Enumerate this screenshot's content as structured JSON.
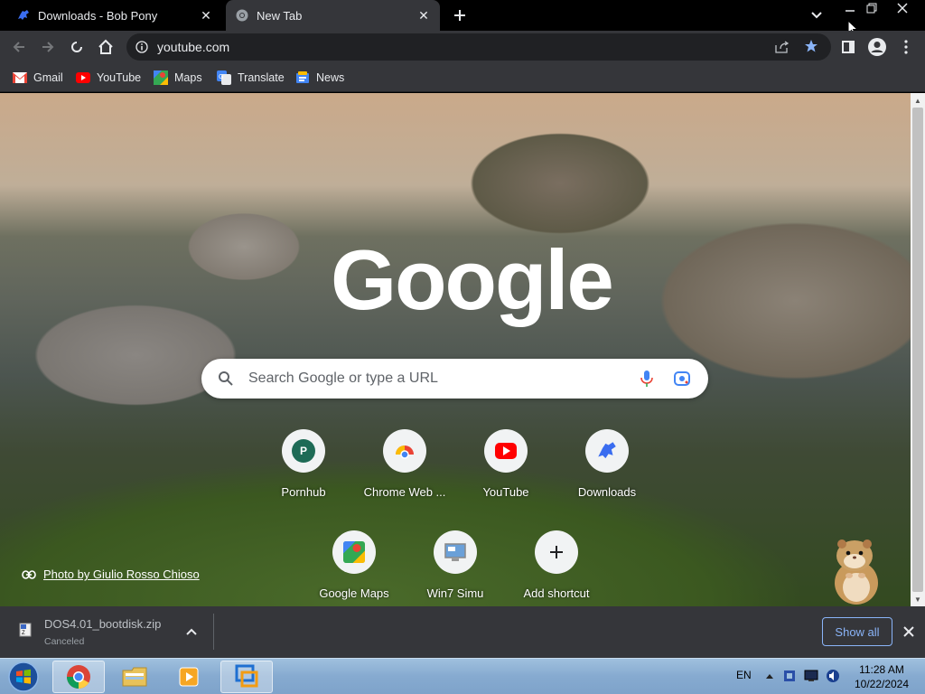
{
  "tabs": [
    {
      "title": "Downloads - Bob Pony",
      "active": false,
      "icon": "bob-pony-icon"
    },
    {
      "title": "New Tab",
      "active": true,
      "icon": "chrome-icon"
    }
  ],
  "toolbar": {
    "url": "youtube.com"
  },
  "bookmarks": [
    {
      "label": "Gmail",
      "icon": "gmail-icon"
    },
    {
      "label": "YouTube",
      "icon": "youtube-icon"
    },
    {
      "label": "Maps",
      "icon": "maps-icon"
    },
    {
      "label": "Translate",
      "icon": "translate-icon"
    },
    {
      "label": "News",
      "icon": "news-icon"
    }
  ],
  "ntp": {
    "logo": "Google",
    "search_placeholder": "Search Google or type a URL",
    "shortcuts": [
      {
        "label": "Pornhub",
        "icon": "letter-p-icon",
        "letter": "P"
      },
      {
        "label": "Chrome Web ...",
        "icon": "chrome-web-store-icon"
      },
      {
        "label": "YouTube",
        "icon": "youtube-icon"
      },
      {
        "label": "Downloads",
        "icon": "bob-pony-icon"
      },
      {
        "label": "Google Maps",
        "icon": "maps-icon"
      },
      {
        "label": "Win7 Simu",
        "icon": "win7-simu-icon"
      },
      {
        "label": "Add shortcut",
        "icon": "plus-icon"
      }
    ],
    "photo_credit": "Photo by Giulio Rosso Chioso"
  },
  "download_bar": {
    "file": "DOS4.01_bootdisk.zip",
    "status": "Canceled",
    "show_all": "Show all"
  },
  "taskbar": {
    "language": "EN",
    "time": "11:28 AM",
    "date": "10/22/2024"
  },
  "colors": {
    "chrome_dark": "#35363a",
    "titlebar": "#000000",
    "accent_blue": "#8ab4f8",
    "bookmark_star": "#8ab4f8",
    "taskbar": "#86aad0"
  }
}
